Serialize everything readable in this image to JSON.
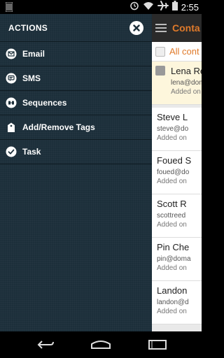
{
  "status_bar": {
    "time": "2:55",
    "icons": [
      "alarm-icon",
      "wifi-icon",
      "airplane-icon",
      "battery-icon"
    ]
  },
  "drawer": {
    "title": "ACTIONS",
    "items": [
      {
        "label": "Email",
        "icon": "email-icon"
      },
      {
        "label": "SMS",
        "icon": "sms-icon"
      },
      {
        "label": "Sequences",
        "icon": "sequences-icon"
      },
      {
        "label": "Add/Remove Tags",
        "icon": "tag-icon"
      },
      {
        "label": "Task",
        "icon": "task-check-icon"
      }
    ]
  },
  "main": {
    "title": "Conta",
    "filter_label": "All cont",
    "contacts": [
      {
        "name": "Lena Re",
        "email": "lena@dom",
        "added": "Added on"
      },
      {
        "name": "Steve L",
        "email": "steve@do",
        "added": "Added on"
      },
      {
        "name": "Foued S",
        "email": "foued@do",
        "added": "Added on"
      },
      {
        "name": "Scott R",
        "email": "scottreed",
        "added": "Added on"
      },
      {
        "name": "Pin Che",
        "email": "pin@doma",
        "added": "Added on"
      },
      {
        "name": "Landon",
        "email": "landon@d",
        "added": "Added on"
      }
    ]
  },
  "colors": {
    "drawer_bg": "#1c2f3a",
    "accent": "#e07a2a"
  }
}
